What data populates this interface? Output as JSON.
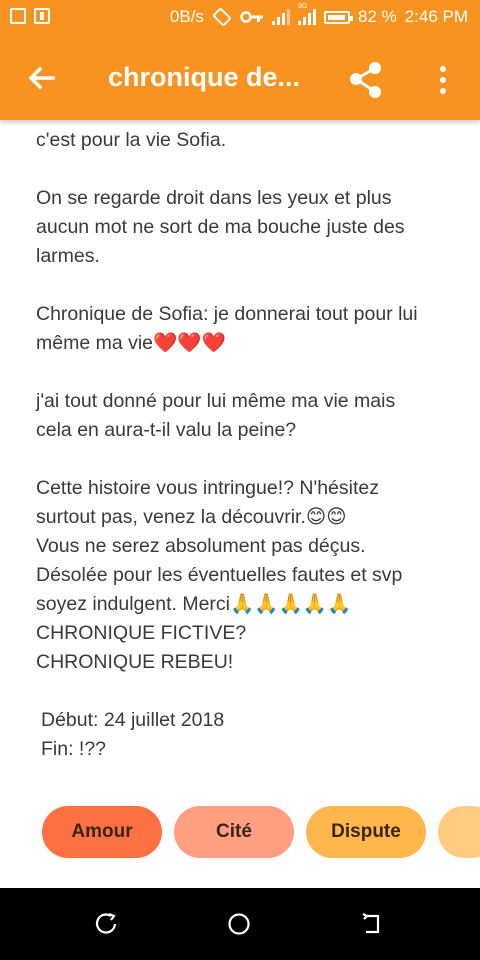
{
  "status_bar": {
    "network_speed": "0B/s",
    "battery_percent": "82 %",
    "time": "2:46 PM",
    "signal_label": "3G",
    "icons": [
      "screenshot-icon",
      "battery-saver-icon",
      "rotate-icon",
      "key-icon",
      "signal-icon",
      "signal-3g-icon",
      "battery-icon"
    ]
  },
  "app_bar": {
    "title": "chronique de...",
    "back_icon": "arrow-left-icon",
    "share_icon": "share-icon",
    "more_icon": "more-vertical-icon"
  },
  "content": {
    "p1": "c'est pour la vie Sofia.",
    "p2_lines": [
      "On se regarde droit dans les yeux et plus",
      "aucun mot ne sort de ma bouche juste des",
      "larmes."
    ],
    "p3_lines": [
      "Chronique de Sofia: je donnerai tout pour lui",
      "même ma vie❤️❤️❤️"
    ],
    "p4_lines": [
      "j'ai tout donné pour lui même ma vie mais",
      "cela en aura-t-il valu la peine?"
    ],
    "p5_lines": [
      "Cette histoire vous intringue!? N'hésitez",
      "surtout pas, venez la découvrir.😊😊",
      "Vous ne serez absolument pas déçus.",
      "Désolée pour les éventuelles fautes et svp",
      "soyez indulgent. Merci🙏🙏🙏🙏🙏",
      "CHRONIQUE FICTIVE?",
      "CHRONIQUE REBEU!"
    ],
    "p6_lines": [
      "Début: 24 juillet 2018",
      "Fin: !??"
    ]
  },
  "tags": [
    "Amour",
    "Cité",
    "Dispute",
    ""
  ],
  "nav_bar": {
    "icons": [
      "recent-apps-icon",
      "home-icon",
      "back-icon"
    ]
  },
  "colors": {
    "accent": "#f7931e",
    "text": "#3a3a3a",
    "tag_amour": "#ff7043",
    "tag_cite": "#ff9e80",
    "tag_dispute": "#ffb74d"
  }
}
